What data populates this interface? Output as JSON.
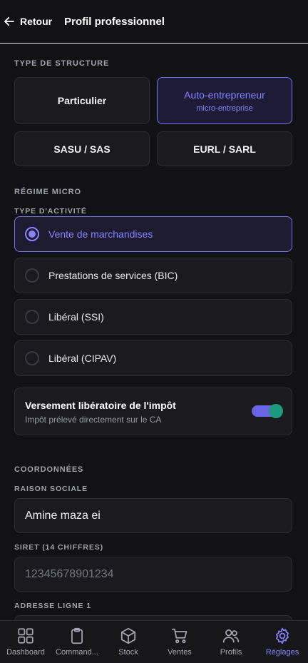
{
  "header": {
    "back_label": "Retour",
    "title": "Profil professionnel"
  },
  "structure": {
    "section_label": "TYPE DE STRUCTURE",
    "options": [
      {
        "label": "Particulier",
        "sub": "",
        "selected": false
      },
      {
        "label": "Auto-entrepreneur",
        "sub": "micro-entreprise",
        "selected": true
      },
      {
        "label": "SASU / SAS",
        "sub": "",
        "selected": false
      },
      {
        "label": "EURL / SARL",
        "sub": "",
        "selected": false
      }
    ]
  },
  "micro": {
    "section_label": "RÉGIME MICRO",
    "activity_label": "TYPE D'ACTIVITÉ",
    "activities": [
      {
        "label": "Vente de marchandises",
        "selected": true
      },
      {
        "label": "Prestations de services (BIC)",
        "selected": false
      },
      {
        "label": "Libéral (SSI)",
        "selected": false
      },
      {
        "label": "Libéral (CIPAV)",
        "selected": false
      }
    ],
    "versement": {
      "title": "Versement libératoire de l'impôt",
      "subtitle": "Impôt prélevé directement sur le CA",
      "enabled": true
    }
  },
  "coordonnees": {
    "section_label": "COORDONNÉES",
    "raison_sociale": {
      "label": "RAISON SOCIALE",
      "value": "Amine maza ei"
    },
    "siret": {
      "label": "SIRET (14 CHIFFRES)",
      "placeholder": "12345678901234"
    },
    "adresse": {
      "label": "ADRESSE LIGNE 1"
    }
  },
  "nav": {
    "items": [
      {
        "label": "Dashboard",
        "icon": "grid-icon",
        "active": false
      },
      {
        "label": "Command...",
        "icon": "clipboard-icon",
        "active": false
      },
      {
        "label": "Stock",
        "icon": "box-icon",
        "active": false
      },
      {
        "label": "Ventes",
        "icon": "cart-icon",
        "active": false
      },
      {
        "label": "Profils",
        "icon": "users-icon",
        "active": false
      },
      {
        "label": "Réglages",
        "icon": "gear-icon",
        "active": true
      }
    ]
  },
  "colors": {
    "accent": "#8b82ff",
    "background": "#121214",
    "card": "#1b1b1f",
    "toggle_knob": "#1a9a80"
  }
}
